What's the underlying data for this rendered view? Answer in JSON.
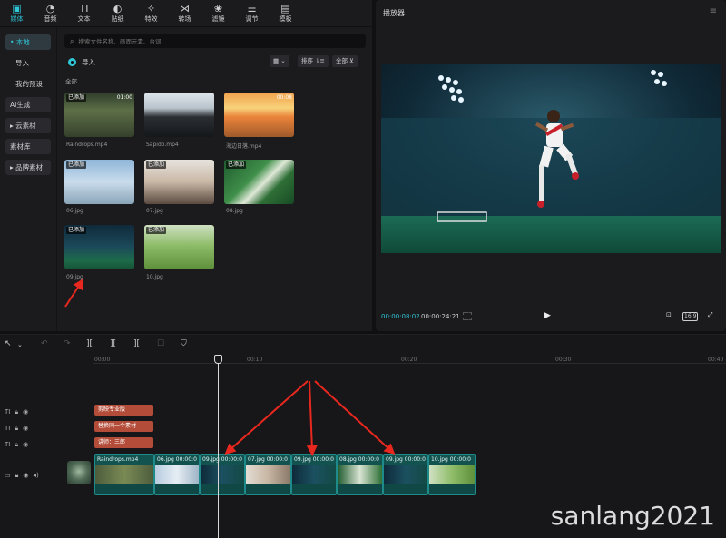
{
  "toolbar": {
    "items": [
      {
        "label": "媒体",
        "icon": "media-icon",
        "glyph": "▣"
      },
      {
        "label": "音频",
        "icon": "audio-icon",
        "glyph": "◔"
      },
      {
        "label": "文本",
        "icon": "text-icon",
        "glyph": "TI"
      },
      {
        "label": "贴纸",
        "icon": "sticker-icon",
        "glyph": "◐"
      },
      {
        "label": "特效",
        "icon": "effects-icon",
        "glyph": "✧"
      },
      {
        "label": "转场",
        "icon": "transition-icon",
        "glyph": "⋈"
      },
      {
        "label": "滤镜",
        "icon": "filter-icon",
        "glyph": "❀"
      },
      {
        "label": "调节",
        "icon": "adjust-icon",
        "glyph": "⚌"
      },
      {
        "label": "模板",
        "icon": "template-icon",
        "glyph": "▤"
      }
    ]
  },
  "sidebar": {
    "items": [
      {
        "label": "• 本地",
        "style": "active"
      },
      {
        "label": "导入",
        "style": "plain"
      },
      {
        "label": "我的预设",
        "style": "plain"
      },
      {
        "label": "AI生成",
        "style": "boxed"
      },
      {
        "label": "▸ 云素材",
        "style": "boxed"
      },
      {
        "label": "素材库",
        "style": "boxed"
      },
      {
        "label": "▸ 品牌素材",
        "style": "boxed"
      }
    ]
  },
  "media": {
    "search_placeholder": "搜索文件名称、画面元素、台词",
    "import_label": "导入",
    "view_label": "▦ ⌄",
    "sort_label": "排序 ⇂≡",
    "filter_label": "全部 ⊻",
    "section_label": "全部",
    "items": [
      {
        "name": "Raindrops.mp4",
        "tag": "已添加",
        "duration": "01:00"
      },
      {
        "name": "Sapido.mp4",
        "tag": "",
        "duration": ""
      },
      {
        "name": "海边日落.mp4",
        "tag": "",
        "duration": "00:08"
      },
      {
        "name": "06.jpg",
        "tag": "已添加",
        "duration": ""
      },
      {
        "name": "07.jpg",
        "tag": "已添加",
        "duration": ""
      },
      {
        "name": "08.jpg",
        "tag": "已添加",
        "duration": ""
      },
      {
        "name": "09.jpg",
        "tag": "已添加",
        "duration": ""
      },
      {
        "name": "10.jpg",
        "tag": "已添加",
        "duration": ""
      }
    ]
  },
  "player": {
    "title": "播放器",
    "menu_glyph": "≡",
    "time_current": "00:00:08:02",
    "time_total": "00:00:24:21",
    "play_glyph": "▶",
    "ratio_label": "16:9",
    "fullscreen_glyph": "⤢",
    "fit_glyph": "⊡"
  },
  "timeline": {
    "ruler": [
      "00:00",
      "00:10",
      "00:20",
      "00:30",
      "00:40"
    ],
    "text_clips": [
      "剪映专业版",
      "替换同一个素材",
      "讲师：三郎"
    ],
    "video_clips": [
      {
        "label": "Raindrops.mp4",
        "time": ""
      },
      {
        "label": "06.jpg",
        "time": "00:00:0"
      },
      {
        "label": "09.jpg",
        "time": "00:00:0"
      },
      {
        "label": "07.jpg",
        "time": "00:00:0"
      },
      {
        "label": "09.jpg",
        "time": "00:00:0"
      },
      {
        "label": "08.jpg",
        "time": "00:00:0"
      },
      {
        "label": "09.jpg",
        "time": "00:00:0"
      },
      {
        "label": "10.jpg",
        "time": "00:00:0"
      }
    ],
    "tools": [
      "↖",
      "⌄",
      "↶",
      "↷",
      "][",
      "][",
      "][",
      "☐",
      "⛉"
    ]
  },
  "watermark": "sanlang2021",
  "colors": {
    "accent": "#2fc6d6",
    "text_clip": "#b34d3a",
    "video_clip": "#155c5c",
    "arrow": "#e8281e"
  }
}
